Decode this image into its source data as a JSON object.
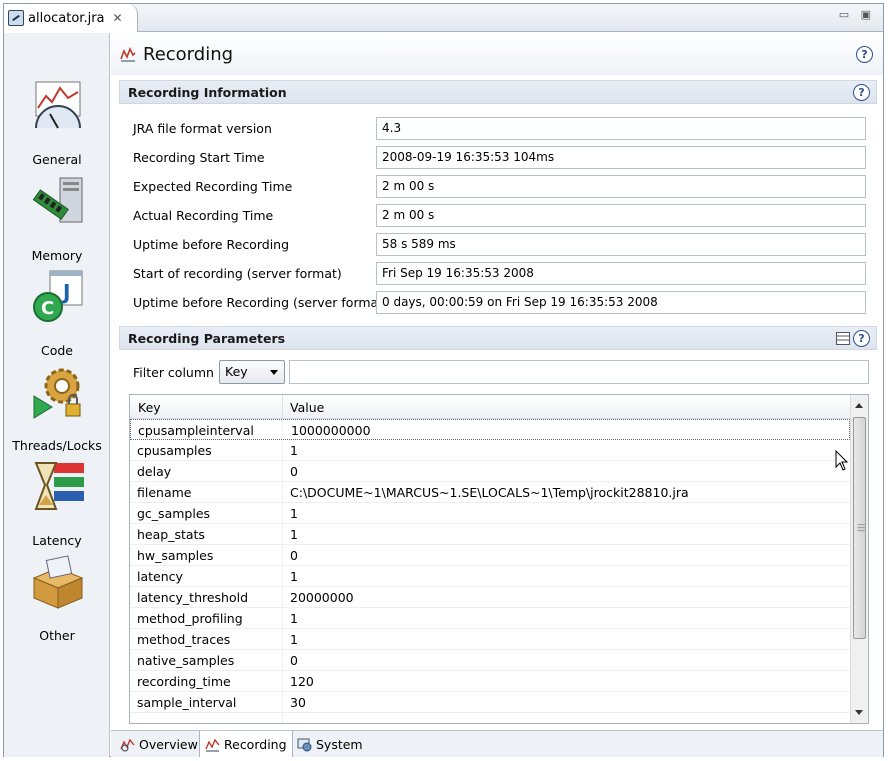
{
  "editor_tab": {
    "label": "allocator.jra",
    "close": "✕"
  },
  "window_controls": "▭ ▣",
  "nav": {
    "items": [
      {
        "label": "General",
        "icon": "general-chart-gauge-icon"
      },
      {
        "label": "Memory",
        "icon": "memory-ram-icon"
      },
      {
        "label": "Code",
        "icon": "code-java-icon"
      },
      {
        "label": "Threads/Locks",
        "icon": "threads-gear-lock-icon"
      },
      {
        "label": "Latency",
        "icon": "latency-hourglass-icon"
      },
      {
        "label": "Other",
        "icon": "other-box-icon"
      }
    ]
  },
  "page": {
    "title": "Recording",
    "help": "?"
  },
  "info_section": {
    "title": "Recording Information",
    "rows": [
      {
        "label": "JRA file format version",
        "value": "4.3"
      },
      {
        "label": "Recording Start Time",
        "value": "2008-09-19 16:35:53 104ms"
      },
      {
        "label": "Expected Recording Time",
        "value": "2 m 00 s"
      },
      {
        "label": "Actual Recording Time",
        "value": "2 m 00 s"
      },
      {
        "label": "Uptime before Recording",
        "value": "58 s 589 ms"
      },
      {
        "label": "Start of recording (server format)",
        "value": "Fri Sep 19 16:35:53 2008"
      },
      {
        "label": "Uptime before Recording (server format)",
        "value": "0 days, 00:00:59 on Fri Sep 19 16:35:53 2008"
      }
    ]
  },
  "params_section": {
    "title": "Recording Parameters",
    "filter_label": "Filter column",
    "filter_selected": "Key",
    "filter_text": "",
    "columns": [
      "Key",
      "Value"
    ],
    "rows": [
      [
        "cpusampleinterval",
        "1000000000"
      ],
      [
        "cpusamples",
        "1"
      ],
      [
        "delay",
        "0"
      ],
      [
        "filename",
        "C:\\DOCUME~1\\MARCUS~1.SE\\LOCALS~1\\Temp\\jrockit28810.jra"
      ],
      [
        "gc_samples",
        "1"
      ],
      [
        "heap_stats",
        "1"
      ],
      [
        "hw_samples",
        "0"
      ],
      [
        "latency",
        "1"
      ],
      [
        "latency_threshold",
        "20000000"
      ],
      [
        "method_profiling",
        "1"
      ],
      [
        "method_traces",
        "1"
      ],
      [
        "native_samples",
        "0"
      ],
      [
        "recording_time",
        "120"
      ],
      [
        "sample_interval",
        "30"
      ]
    ],
    "selected_row": 0
  },
  "bottom_tabs": [
    {
      "label": "Overview",
      "icon": "overview-icon",
      "active": false
    },
    {
      "label": "Recording",
      "icon": "recording-icon",
      "active": true
    },
    {
      "label": "System",
      "icon": "system-icon",
      "active": false
    }
  ],
  "colors": {
    "accent": "#2d4f8a",
    "section_bg": "#e4eaf2",
    "nav_bg": "#eef1f5"
  }
}
